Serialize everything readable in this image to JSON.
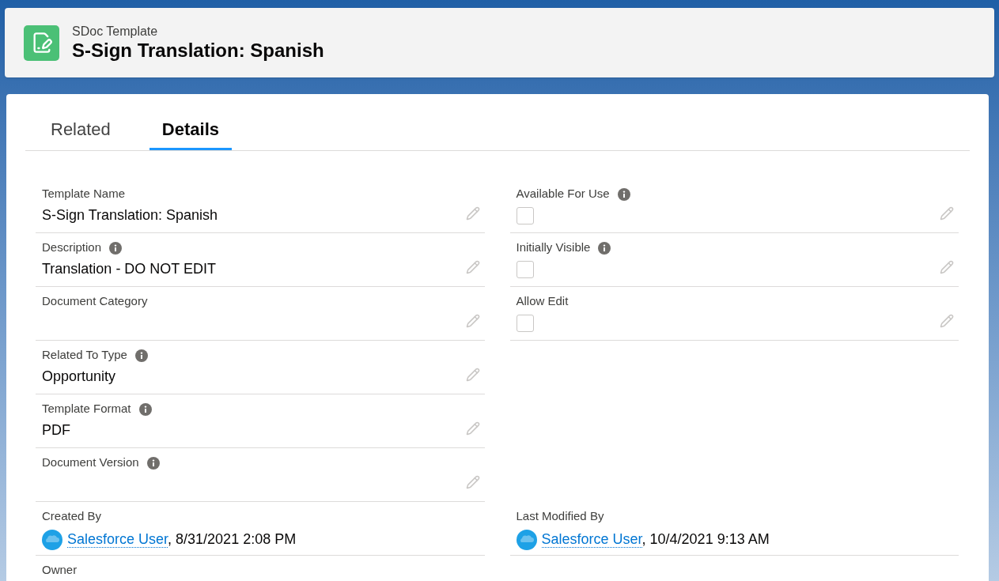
{
  "header": {
    "object_type": "SDoc Template",
    "title": "S-Sign Translation: Spanish"
  },
  "tabs": [
    {
      "label": "Related",
      "selected": false
    },
    {
      "label": "Details",
      "selected": true
    }
  ],
  "rows": [
    {
      "left": {
        "kind": "text",
        "label": "Template Name",
        "info": false,
        "value": "S-Sign Translation: Spanish",
        "editable": true
      },
      "right": {
        "kind": "checkbox",
        "label": "Available For Use",
        "info": true,
        "checked": false,
        "editable": true
      }
    },
    {
      "left": {
        "kind": "text",
        "label": "Description",
        "info": true,
        "value": "Translation - DO NOT EDIT",
        "editable": true
      },
      "right": {
        "kind": "checkbox",
        "label": "Initially Visible",
        "info": true,
        "checked": false,
        "editable": true
      }
    },
    {
      "left": {
        "kind": "text",
        "label": "Document Category",
        "info": false,
        "editable": true
      },
      "right": {
        "kind": "checkbox",
        "label": "Allow Edit",
        "info": false,
        "checked": false,
        "editable": true
      }
    },
    {
      "left": {
        "kind": "text",
        "label": "Related To Type",
        "info": true,
        "value": "Opportunity",
        "editable": true
      }
    },
    {
      "left": {
        "kind": "text",
        "label": "Template Format",
        "info": true,
        "value": "PDF",
        "editable": true
      }
    },
    {
      "left": {
        "kind": "text",
        "label": "Document Version",
        "info": true,
        "editable": true
      }
    },
    {
      "left": {
        "kind": "user",
        "label": "Created By",
        "info": false,
        "user": "Salesforce User",
        "date": ", 8/31/2021 2:08 PM",
        "editable": false
      },
      "right": {
        "kind": "user",
        "label": "Last Modified By",
        "info": false,
        "user": "Salesforce User",
        "date": ", 10/4/2021 9:13 AM",
        "editable": false
      }
    },
    {
      "left": {
        "kind": "text",
        "label": "Owner",
        "info": false,
        "editable": false
      }
    }
  ]
}
